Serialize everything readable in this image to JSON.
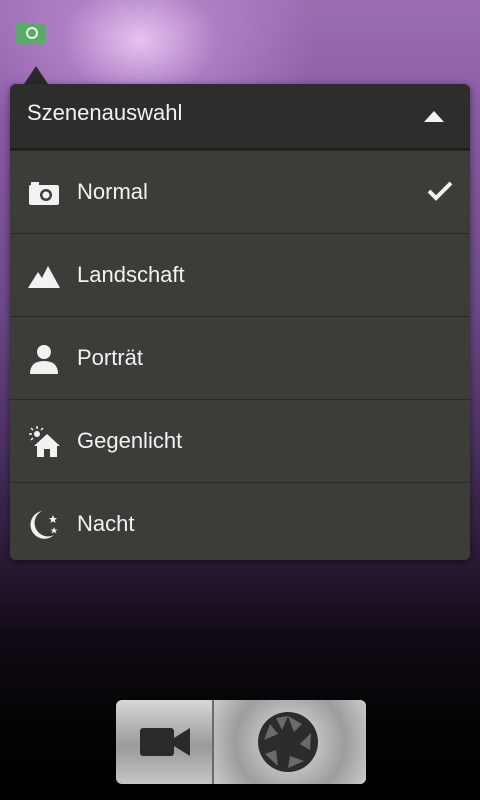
{
  "scene_menu": {
    "title": "Szenenauswahl",
    "selected": "Normal",
    "items": [
      {
        "label": "Normal",
        "icon": "camera-icon"
      },
      {
        "label": "Landschaft",
        "icon": "mountain-icon"
      },
      {
        "label": "Porträt",
        "icon": "person-icon"
      },
      {
        "label": "Gegenlicht",
        "icon": "backlight-house-icon"
      },
      {
        "label": "Nacht",
        "icon": "moon-stars-icon"
      }
    ]
  },
  "indicator": {
    "icon": "scene-camera-icon",
    "color": "#5aaa6a"
  },
  "controls": {
    "video_icon": "video-camera-icon",
    "shutter_icon": "shutter-icon"
  }
}
